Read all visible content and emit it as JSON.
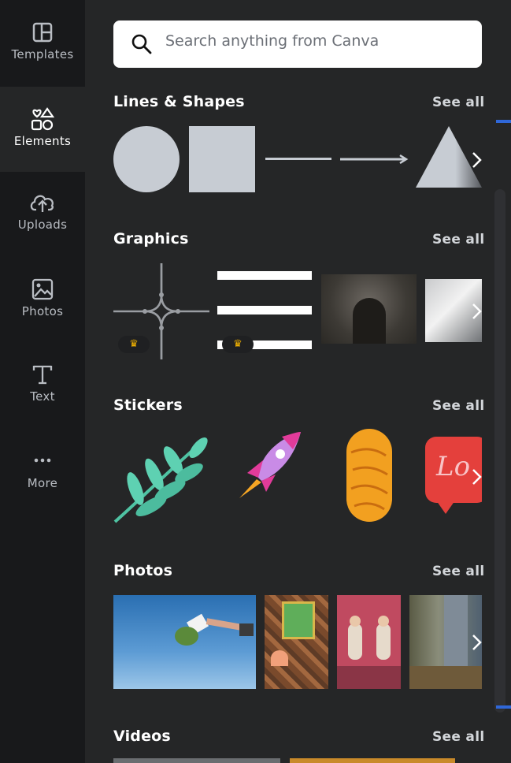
{
  "sidebar": {
    "items": [
      {
        "label": "Templates",
        "icon": "templates-icon"
      },
      {
        "label": "Elements",
        "icon": "elements-icon",
        "active": true
      },
      {
        "label": "Uploads",
        "icon": "upload-cloud-icon"
      },
      {
        "label": "Photos",
        "icon": "photos-icon"
      },
      {
        "label": "Text",
        "icon": "text-icon"
      },
      {
        "label": "More",
        "icon": "more-icon"
      }
    ]
  },
  "search": {
    "placeholder": "Search anything from Canva"
  },
  "sections": {
    "lines_shapes": {
      "title": "Lines & Shapes",
      "see_all": "See all"
    },
    "graphics": {
      "title": "Graphics",
      "see_all": "See all"
    },
    "stickers": {
      "title": "Stickers",
      "see_all": "See all"
    },
    "photos": {
      "title": "Photos",
      "see_all": "See all"
    },
    "videos": {
      "title": "Videos",
      "see_all": "See all"
    }
  },
  "colors": {
    "accent": "#2f67d8",
    "shape_fill": "#c7ccd3",
    "premium_crown": "#f4b400"
  },
  "premium_badge": "♛"
}
